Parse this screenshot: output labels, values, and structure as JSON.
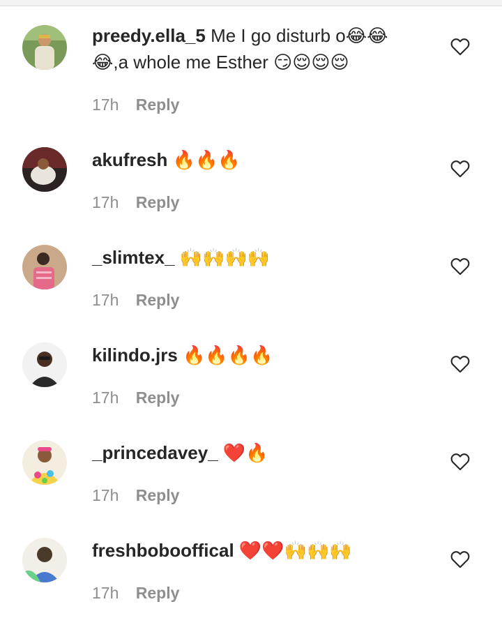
{
  "comments": [
    {
      "username": "preedy.ella_5",
      "text_line1": "Me I go disturb o😂😂",
      "text_line2": "😂,a whole me Esther 😏😌😌😌",
      "time": "17h",
      "reply_label": "Reply",
      "avatar_colors": [
        "#7a9a5a",
        "#e8e2d0",
        "#3d5a2a"
      ]
    },
    {
      "username": "akufresh",
      "text_line1": "🔥🔥🔥",
      "time": "17h",
      "reply_label": "Reply",
      "avatar_colors": [
        "#6b2a2a",
        "#e9e4dc",
        "#2b2222"
      ]
    },
    {
      "username": "_slimtex_",
      "text_line1": "🙌🙌🙌🙌",
      "time": "17h",
      "reply_label": "Reply",
      "avatar_colors": [
        "#c9a98a",
        "#e56a8a",
        "#3a2a22"
      ]
    },
    {
      "username": "kilindo.jrs",
      "text_line1": "🔥🔥🔥🔥",
      "time": "17h",
      "reply_label": "Reply",
      "avatar_colors": [
        "#f2f2f2",
        "#2a2a2a",
        "#c8c8c8"
      ]
    },
    {
      "username": "_princedavey_",
      "text_line1": "❤️🔥",
      "time": "17h",
      "reply_label": "Reply",
      "avatar_colors": [
        "#f5d24a",
        "#e84a8a",
        "#4ac0e8"
      ]
    },
    {
      "username": "freshbobooffical",
      "text_line1": "❤️❤️🙌🙌🙌",
      "time": "17h",
      "reply_label": "Reply",
      "avatar_colors": [
        "#f2efe8",
        "#4a7ad0",
        "#4a3a2a"
      ]
    }
  ],
  "icons": {
    "like": "heart-outline-icon"
  },
  "colors": {
    "username": "#262626",
    "meta": "#8e8e8e",
    "divider": "#dcdcdc"
  }
}
